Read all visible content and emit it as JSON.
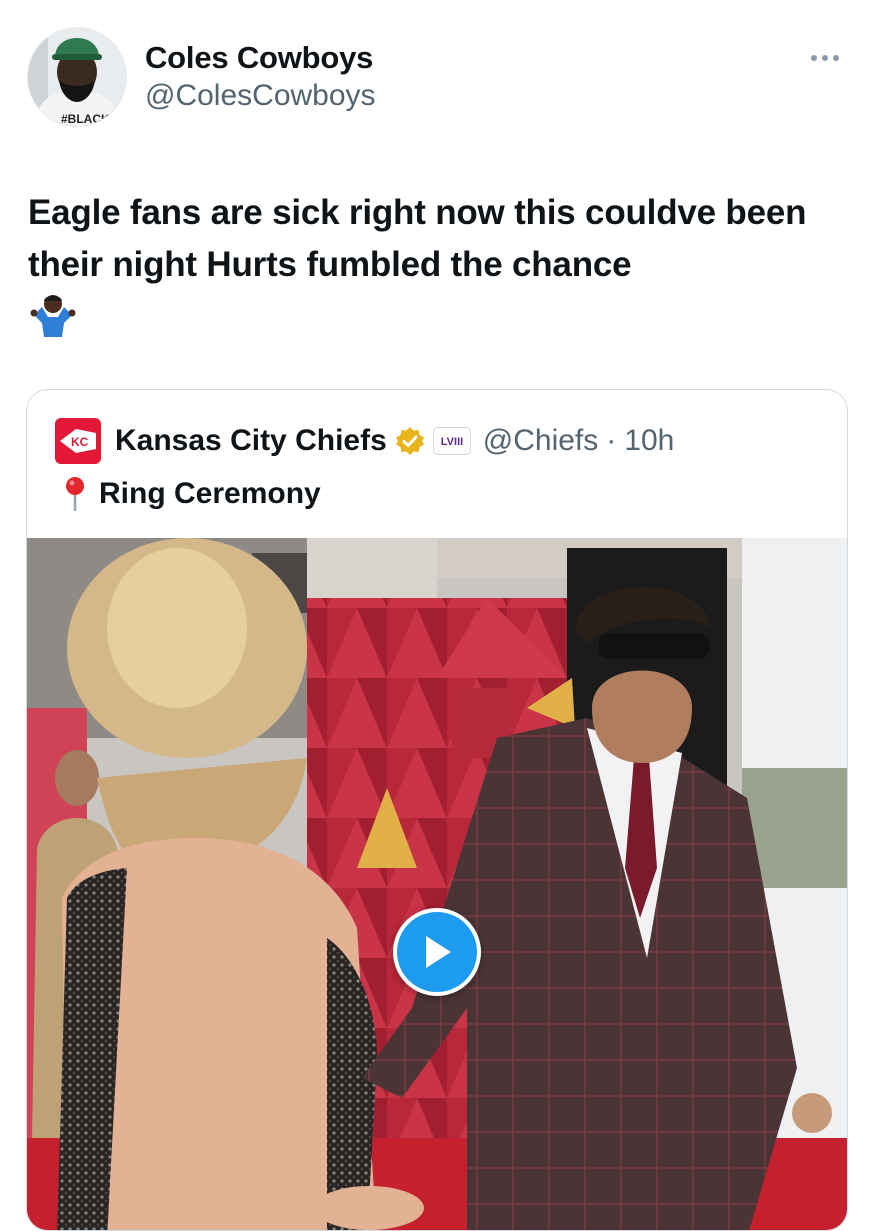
{
  "tweet": {
    "author": {
      "display_name": "Coles Cowboys",
      "handle": "@ColesCowboys",
      "avatar_icon": "profile-photo-avatar",
      "avatar_shirt_text": "#BLACK"
    },
    "more_icon": "more-dots-icon",
    "text": "Eagle fans are sick right now this couldve been their night Hurts fumbled the chance",
    "emoji": "🤷🏿‍♂️"
  },
  "quoted": {
    "avatar_icon": "chiefs-logo",
    "avatar_text": "KC",
    "name": "Kansas City Chiefs",
    "verified_icon": "gold-verified-badge-icon",
    "affiliate_badge_icon": "super-bowl-lviii-badge",
    "affiliate_badge_text": "LVIII",
    "handle": "@Chiefs",
    "separator": "·",
    "time": "10h",
    "location_icon": "red-pin-icon",
    "location": "Ring Ceremony",
    "media": {
      "type": "video",
      "thumbnail": "red-carpet-photo",
      "play_icon": "play-icon"
    }
  },
  "colors": {
    "text_primary": "#0f1419",
    "text_secondary": "#536471",
    "border": "#cfd9de",
    "accent_blue": "#1d9bf0",
    "chiefs_red": "#e31837",
    "verified_gold": "#e8b41c"
  }
}
